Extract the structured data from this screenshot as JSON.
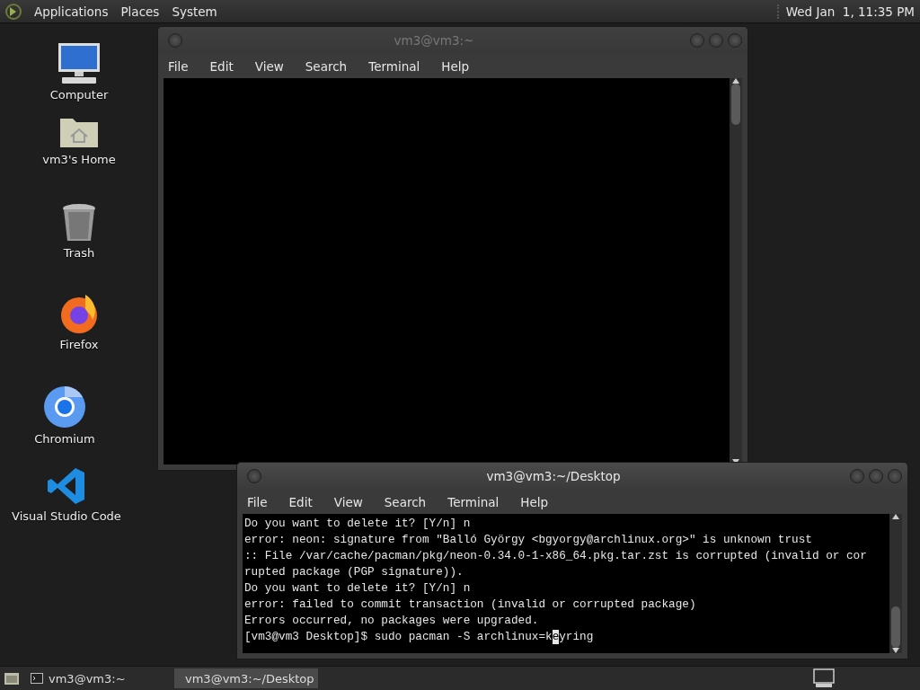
{
  "top_panel": {
    "menus": [
      "Applications",
      "Places",
      "System"
    ],
    "clock": "Wed Jan  1, 11:35 PM"
  },
  "desktop_icons": [
    {
      "kind": "computer",
      "label": "Computer"
    },
    {
      "kind": "home",
      "label": "vm3's Home"
    },
    {
      "kind": "trash",
      "label": "Trash"
    },
    {
      "kind": "firefox",
      "label": "Firefox"
    },
    {
      "kind": "chromium",
      "label": "Chromium"
    },
    {
      "kind": "vscode",
      "label": "Visual Studio Code"
    }
  ],
  "windows": [
    {
      "title": "vm3@vm3:~",
      "active": false,
      "menu": [
        "File",
        "Edit",
        "View",
        "Search",
        "Terminal",
        "Help"
      ]
    },
    {
      "title": "vm3@vm3:~/Desktop",
      "active": true,
      "menu": [
        "File",
        "Edit",
        "View",
        "Search",
        "Terminal",
        "Help"
      ],
      "lines": [
        "Do you want to delete it? [Y/n] n",
        "error: neon: signature from \"Balló György <bgyorgy@archlinux.org>\" is unknown trust",
        ":: File /var/cache/pacman/pkg/neon-0.34.0-1-x86_64.pkg.tar.zst is corrupted (invalid or cor",
        "rupted package (PGP signature)).",
        "Do you want to delete it? [Y/n] n",
        "error: failed to commit transaction (invalid or corrupted package)",
        "Errors occurred, no packages were upgraded."
      ],
      "input": {
        "before": "[vm3@vm3 Desktop]$ sudo pacman -S archlinux=k",
        "cursor": "e",
        "after": "yring"
      }
    }
  ],
  "taskbar": {
    "tasks": [
      {
        "label": "vm3@vm3:~",
        "selected": false
      },
      {
        "label": "vm3@vm3:~/Desktop",
        "selected": true
      }
    ]
  }
}
